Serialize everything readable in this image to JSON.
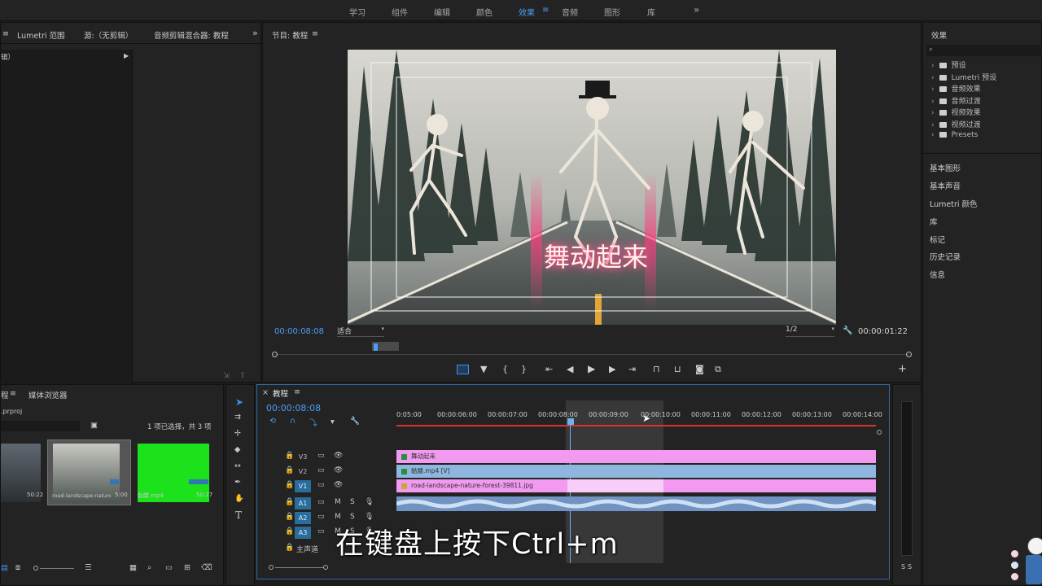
{
  "workspaces": [
    "学习",
    "组件",
    "编辑",
    "颜色",
    "效果",
    "音频",
    "图形",
    "库"
  ],
  "workspace_active": "效果",
  "overflow_icon": "»",
  "source_panel": {
    "tabs": [
      "Lumetri 范围",
      "源:（无剪辑）",
      "音频剪辑混合器: 教程"
    ],
    "sub_label": "辑）"
  },
  "program": {
    "title": "节目: 教程",
    "menu": "≡",
    "video_title": "舞动起来",
    "timecode": "00:00:08:08",
    "fit": "适合",
    "resolution": "1/2",
    "duration": "00:00:01:22"
  },
  "effects_panel": {
    "title": "效果",
    "items": [
      "预设",
      "Lumetri 预设",
      "音频效果",
      "音频过渡",
      "视频效果",
      "视频过渡",
      "Presets"
    ],
    "sections": [
      "基本图形",
      "基本声音",
      "Lumetri 颜色",
      "库",
      "标记",
      "历史记录",
      "信息"
    ]
  },
  "project_panel": {
    "tabs": [
      "媒体浏览器"
    ],
    "file": ".prproj",
    "selection": "1 项已选择，共 3 项",
    "items": [
      {
        "name": "",
        "duration": "50:22"
      },
      {
        "name": "road-landscape-nature...",
        "duration": "5:00"
      },
      {
        "name": "骷髅.mp4",
        "duration": "50:27"
      }
    ]
  },
  "timeline": {
    "title": "教程",
    "timecode": "00:00:08:08",
    "ruler": [
      "0:05:00",
      "00:00:06:00",
      "00:00:07:00",
      "00:00:08:00",
      "00:00:09:00",
      "00:00:10:00",
      "00:00:11:00",
      "00:00:12:00",
      "00:00:13:00",
      "00:00:14:00"
    ],
    "tracks": [
      {
        "label": "V3",
        "clip": "舞动起来"
      },
      {
        "label": "V2",
        "clip": "骷髅.mp4 [V]"
      },
      {
        "label": "V1",
        "clip": "road-landscape-nature-forest-39811.jpg"
      },
      {
        "label": "A1",
        "clip": ""
      },
      {
        "label": "A2",
        "clip": ""
      },
      {
        "label": "A3",
        "clip": ""
      }
    ],
    "master": "主声道",
    "m_label": "M",
    "s_label": "S"
  },
  "meter": {
    "labels": [
      "S",
      "S"
    ]
  },
  "subtitle": "在键盘上按下Ctrl+m",
  "colors": {
    "accent": "#4a9ff5",
    "clip_pink": "#f19af0",
    "clip_blue": "#8fb6de",
    "audio_clip": "#6f93c2",
    "playhead": "#6fb1f3"
  }
}
